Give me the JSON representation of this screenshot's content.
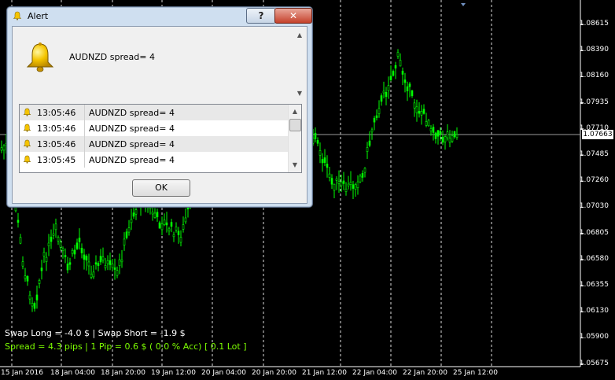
{
  "chart": {
    "colors": {
      "background": "#000000",
      "candles": "#00ff00",
      "grid": "#ffffff",
      "text": "#ffffff",
      "info_green": "#7cfc00"
    },
    "price_axis": [
      "1.08615",
      "1.08390",
      "1.08160",
      "1.07935",
      "1.07710",
      "1.07485",
      "1.07260",
      "1.07030",
      "1.06805",
      "1.06580",
      "1.06355",
      "1.06130",
      "1.05900",
      "1.05675"
    ],
    "current_price": "1.07663",
    "date_axis": [
      "15 Jan 2016",
      "18 Jan 04:00",
      "18 Jan 20:00",
      "19 Jan 12:00",
      "20 Jan 04:00",
      "20 Jan 20:00",
      "21 Jan 12:00",
      "22 Jan 04:00",
      "22 Jan 20:00",
      "25 Jan 12:00"
    ],
    "swap_line": "Swap Long = -4.0 $  | Swap Short = -1.9 $",
    "spread_line": "Spread = 4.3 pips | 1 Pip = 0.6 $ ( 0.0 % Acc) [ 0.1 Lot ]"
  },
  "alert": {
    "title": "Alert",
    "title_icon": "bell-icon",
    "help_label": "?",
    "close_label": "✕",
    "message": "AUDNZD  spread=  4",
    "rows": [
      {
        "time": "13:05:46",
        "message": "AUDNZD  spread=  4"
      },
      {
        "time": "13:05:46",
        "message": "AUDNZD  spread=  4"
      },
      {
        "time": "13:05:46",
        "message": "AUDNZD  spread=  4"
      },
      {
        "time": "13:05:45",
        "message": "AUDNZD  spread=  4"
      }
    ],
    "ok_label": "OK"
  }
}
